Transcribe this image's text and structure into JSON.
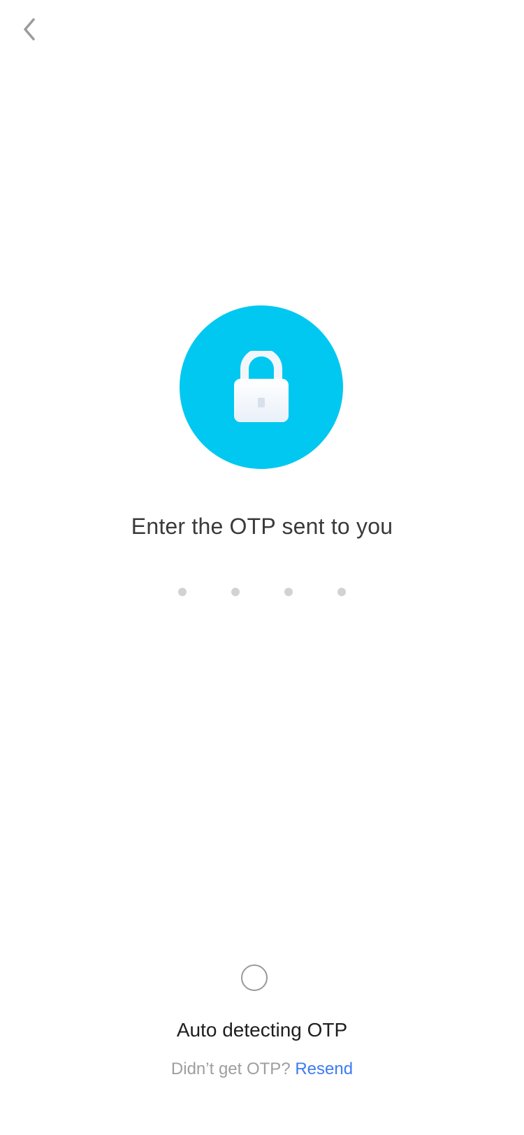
{
  "header": {
    "back_icon": "chevron-left-icon"
  },
  "hero": {
    "icon": "lock-icon",
    "circle_color": "#00C8F0"
  },
  "otp": {
    "title": "Enter the OTP sent to you",
    "digits": [
      "",
      "",
      "",
      ""
    ]
  },
  "status": {
    "spinner_icon": "spinner-icon",
    "auto_detect_text": "Auto detecting OTP",
    "didnt_get_text": "Didn’t get OTP?",
    "resend_label": "Resend",
    "link_color": "#3D7BF2"
  }
}
